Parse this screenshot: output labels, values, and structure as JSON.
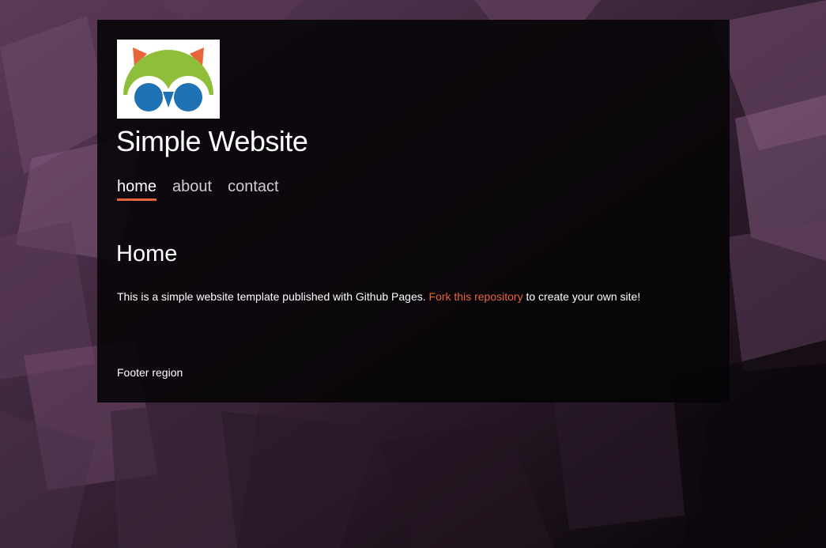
{
  "site": {
    "title": "Simple Website"
  },
  "nav": {
    "items": [
      {
        "label": "home"
      },
      {
        "label": "about"
      },
      {
        "label": "contact"
      }
    ]
  },
  "main": {
    "heading": "Home",
    "intro_before": "This is a simple website template published with Github Pages. ",
    "intro_link": "Fork this repository",
    "intro_after": " to create your own site!"
  },
  "footer": {
    "text": "Footer region"
  },
  "colors": {
    "accent": "#e8653a",
    "logo_green": "#8fbf3a",
    "logo_blue": "#1f73b5",
    "logo_ear": "#e8653a"
  }
}
